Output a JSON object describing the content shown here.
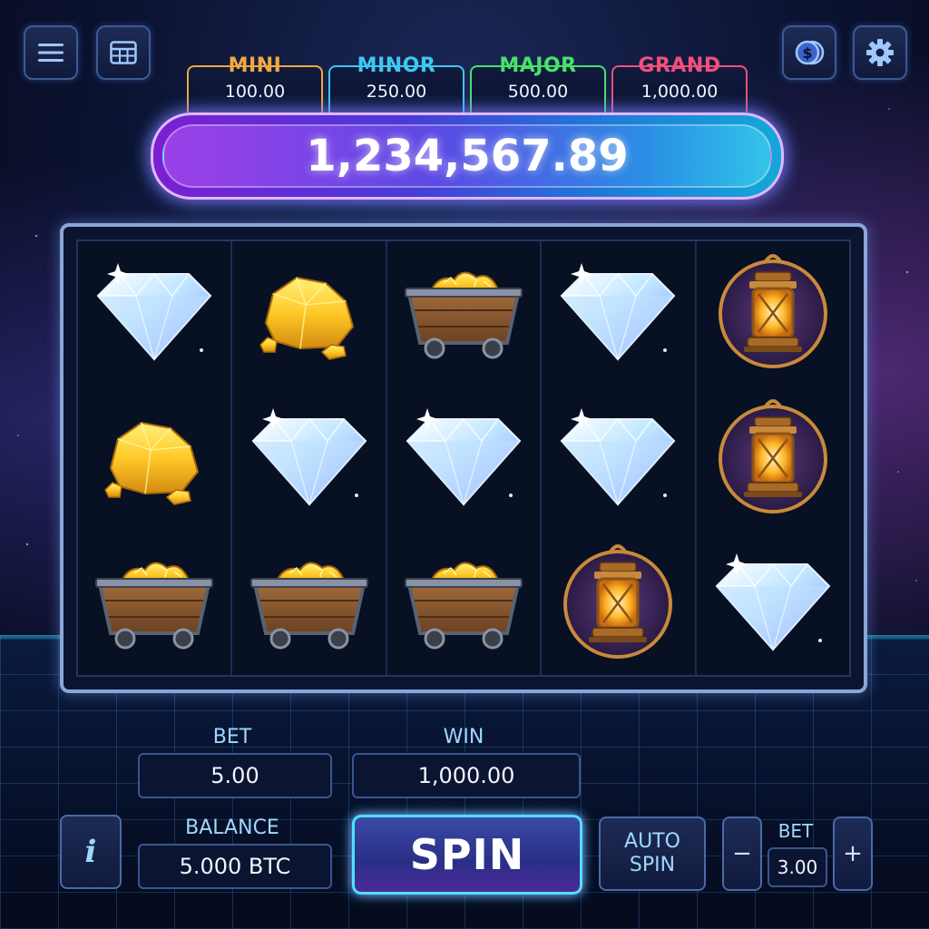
{
  "jackpots": [
    {
      "title": "MINI",
      "value": "100.00",
      "color": "#f0a840"
    },
    {
      "title": "MINOR",
      "value": "250.00",
      "color": "#3ec8f0"
    },
    {
      "title": "MAJOR",
      "value": "500.00",
      "color": "#49e06a"
    },
    {
      "title": "GRAND",
      "value": "1,000.00",
      "color": "#f0507a"
    }
  ],
  "main_jackpot": "1,234,567.89",
  "top_left_buttons": [
    "menu-icon",
    "paytable-icon"
  ],
  "top_right_buttons": [
    "coin-icon",
    "gear-icon"
  ],
  "reels": [
    [
      "diamond",
      "gold-nugget",
      "gold-cart"
    ],
    [
      "gold-nugget",
      "diamond",
      "gold-cart"
    ],
    [
      "gold-cart",
      "diamond",
      "gold-cart"
    ],
    [
      "diamond",
      "diamond",
      "lantern"
    ],
    [
      "lantern",
      "lantern",
      "diamond"
    ]
  ],
  "bet": {
    "label": "BET",
    "value": "5.00"
  },
  "win": {
    "label": "WIN",
    "value": "1,000.00"
  },
  "balance": {
    "label": "BALANCE",
    "value": "5.000 BTC"
  },
  "info_label": "i",
  "spin_label": "SPIN",
  "auto_spin": {
    "line1": "AUTO",
    "line2": "SPIN"
  },
  "bet_stepper": {
    "label": "BET",
    "value": "3.00",
    "minus": "−",
    "plus": "+"
  }
}
